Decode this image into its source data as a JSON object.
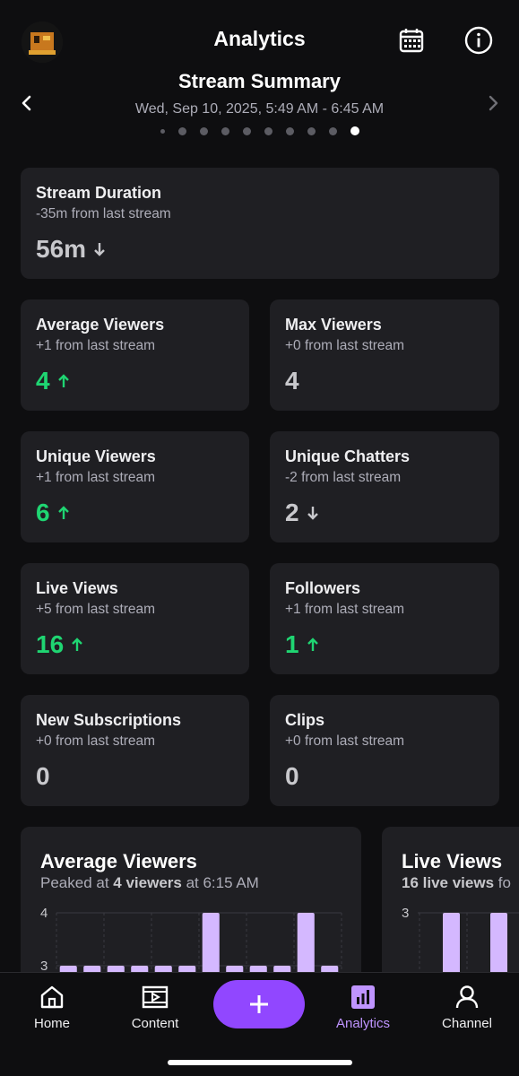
{
  "header": {
    "title": "Analytics",
    "summary_title": "Stream Summary",
    "summary_date": "Wed, Sep 10, 2025, 5:49 AM - 6:45 AM",
    "page_dots": 10,
    "active_dot": 9
  },
  "cards": {
    "stream_duration": {
      "label": "Stream Duration",
      "sub": "-35m from last stream",
      "value": "56m",
      "trend": "down"
    },
    "average_viewers": {
      "label": "Average Viewers",
      "sub": "+1 from last stream",
      "value": "4",
      "trend": "up"
    },
    "max_viewers": {
      "label": "Max Viewers",
      "sub": "+0 from last stream",
      "value": "4",
      "trend": "flat"
    },
    "unique_viewers": {
      "label": "Unique Viewers",
      "sub": "+1 from last stream",
      "value": "6",
      "trend": "up"
    },
    "unique_chatters": {
      "label": "Unique Chatters",
      "sub": "-2 from last stream",
      "value": "2",
      "trend": "down"
    },
    "live_views": {
      "label": "Live Views",
      "sub": "+5 from last stream",
      "value": "16",
      "trend": "up"
    },
    "followers": {
      "label": "Followers",
      "sub": "+1 from last stream",
      "value": "1",
      "trend": "up"
    },
    "new_subscriptions": {
      "label": "New Subscriptions",
      "sub": "+0 from last stream",
      "value": "0",
      "trend": "flat"
    },
    "clips": {
      "label": "Clips",
      "sub": "+0 from last stream",
      "value": "0",
      "trend": "flat"
    }
  },
  "charts": {
    "avg_viewers": {
      "title": "Average Viewers",
      "sub_prefix": "Peaked at ",
      "sub_bold": "4 viewers",
      "sub_suffix": " at 6:15 AM"
    },
    "live_views": {
      "title": "Live Views",
      "sub_prefix": "",
      "sub_bold": "16 live views",
      "sub_suffix": " fo"
    }
  },
  "chart_data": [
    {
      "type": "bar",
      "title": "Average Viewers",
      "ylim": [
        3,
        4
      ],
      "y_ticks": [
        "4",
        "3"
      ],
      "values": [
        3,
        3,
        3,
        3,
        3,
        3,
        4,
        3,
        3,
        3,
        4,
        3
      ],
      "color": "#d4b8ff"
    },
    {
      "type": "bar",
      "title": "Live Views",
      "y_ticks": [
        "3"
      ],
      "values": [
        3,
        3
      ],
      "color": "#d4b8ff"
    }
  ],
  "nav": {
    "items": [
      {
        "label": "Home",
        "icon": "home-icon"
      },
      {
        "label": "Content",
        "icon": "film-icon"
      },
      {
        "label": "Analytics",
        "icon": "bar-chart-icon",
        "active": true
      },
      {
        "label": "Channel",
        "icon": "user-icon"
      }
    ]
  },
  "colors": {
    "background": "#0e0e10",
    "card": "#1f1f23",
    "accent": "#9147ff",
    "accent_light": "#bf94ff",
    "up": "#1fd572"
  }
}
